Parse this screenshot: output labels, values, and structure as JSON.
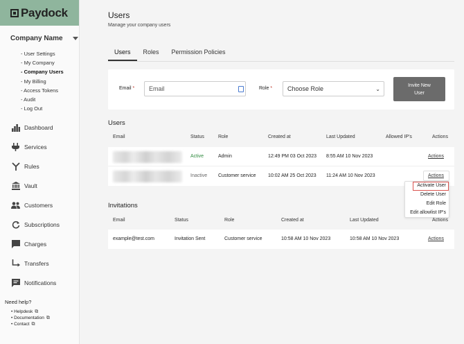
{
  "sidebar": {
    "logo": "Paydock",
    "company": "Company Name",
    "sub_items": [
      "- User Settings",
      "- My Company",
      "- Company Users",
      "- My Billing",
      "- Access Tokens",
      "- Audit",
      "- Log Out"
    ],
    "nav": [
      {
        "label": "Dashboard",
        "icon": "dashboard-icon"
      },
      {
        "label": "Services",
        "icon": "plug-icon"
      },
      {
        "label": "Rules",
        "icon": "rules-icon"
      },
      {
        "label": "Vault",
        "icon": "bank-icon"
      },
      {
        "label": "Customers",
        "icon": "people-icon"
      },
      {
        "label": "Subscriptions",
        "icon": "refresh-icon"
      },
      {
        "label": "Charges",
        "icon": "charges-icon"
      },
      {
        "label": "Transfers",
        "icon": "transfer-icon"
      },
      {
        "label": "Notifications",
        "icon": "notifications-icon"
      }
    ],
    "help_title": "Need help?",
    "help_links": [
      "Helpdesk",
      "Documentation",
      "Contact"
    ]
  },
  "header": {
    "title": "Users",
    "subtitle": "Manage your company users"
  },
  "tabs": [
    "Users",
    "Roles",
    "Permission Policies"
  ],
  "invite": {
    "email_label": "Email",
    "email_placeholder": "Email",
    "role_label": "Role",
    "role_value": "Choose Role",
    "button": "Invite New User"
  },
  "users": {
    "title": "Users",
    "columns": [
      "Email",
      "Status",
      "Role",
      "Created at",
      "Last Updated",
      "Allowed IP's",
      "Actions"
    ],
    "rows": [
      {
        "status": "Active",
        "role": "Admin",
        "created": "12:49 PM 03 Oct 2023",
        "updated": "8:55 AM 10 Nov 2023",
        "actions": "Actions"
      },
      {
        "status": "Inactive",
        "role": "Customer service",
        "created": "10:02 AM 25 Oct 2023",
        "updated": "11:24 AM 10 Nov 2023",
        "actions": "Actions"
      }
    ]
  },
  "dropdown": [
    "Activate User",
    "Delete User",
    "Edit Role",
    "Edit allowlist IP's"
  ],
  "invitations": {
    "title": "Invitations",
    "columns": [
      "Email",
      "Status",
      "Role",
      "Created at",
      "Last Updated",
      "Actions"
    ],
    "rows": [
      {
        "email": "example@test.com",
        "status": "Invitation Sent",
        "role": "Customer service",
        "created": "10:58 AM 10 Nov 2023",
        "updated": "10:58 AM 10 Nov 2023",
        "actions": "Actions"
      }
    ]
  },
  "colors": {
    "brand": "#8fb59d",
    "active": "#2e8a3e",
    "highlight": "#d9534f",
    "button": "#6b6b6b"
  }
}
